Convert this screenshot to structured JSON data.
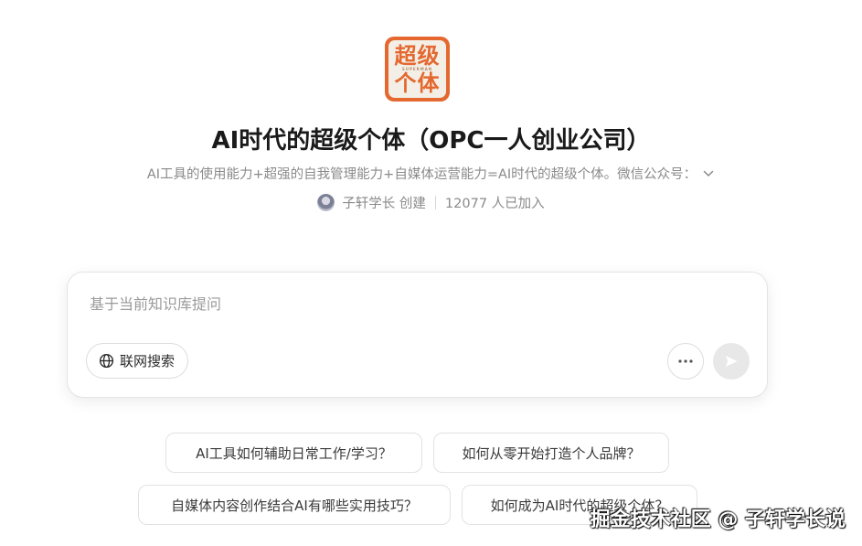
{
  "header": {
    "logo": {
      "line1": "超级",
      "tagline": "SUPERMAN",
      "line2": "个体"
    },
    "title": "AI时代的超级个体（OPC一人创业公司）",
    "description": "AI工具的使用能力+超强的自我管理能力+自媒体运营能力=AI时代的超级个体。微信公众号：",
    "creator": "子轩学长 创建",
    "members": "12077 人已加入"
  },
  "ask": {
    "placeholder": "基于当前知识库提问",
    "web_search_label": "联网搜索",
    "more_icon": "more-horizontal-icon",
    "send_icon": "send-icon"
  },
  "suggestions": [
    {
      "label": "AI工具如何辅助日常工作/学习？"
    },
    {
      "label": "如何从零开始打造个人品牌？"
    },
    {
      "label": "自媒体内容创作结合AI有哪些实用技巧？"
    },
    {
      "label": "如何成为AI时代的超级个体？"
    }
  ],
  "watermark": "掘金技术社区 @ 子轩学长说",
  "colors": {
    "brand": "#e4682f",
    "muted_text": "#8a8a8a",
    "send_disabled": "#e8e8e8"
  }
}
